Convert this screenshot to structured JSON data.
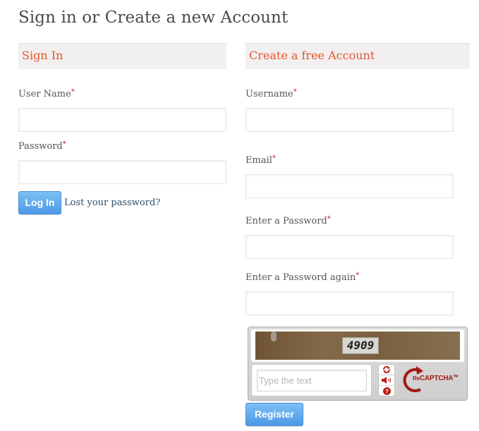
{
  "page": {
    "title": "Sign in or Create a new Account"
  },
  "sign_in": {
    "header": "Sign In",
    "username_label": "User Name",
    "username_value": "",
    "password_label": "Password",
    "password_value": "",
    "required_marker": "*",
    "login_button": "Log In",
    "lost_password_link": "Lost your password?"
  },
  "register": {
    "header": "Create a free Account",
    "username_label": "Username",
    "username_value": "",
    "email_label": "Email",
    "email_value": "",
    "password_label": "Enter a Password",
    "password_value": "",
    "password_again_label": "Enter a Password again",
    "password_again_value": "",
    "required_marker": "*",
    "register_button": "Register"
  },
  "captcha": {
    "image_text": "4909",
    "input_placeholder": "Type the text",
    "input_value": "",
    "controls": [
      "refresh-icon",
      "audio-icon",
      "help-icon"
    ],
    "brand_prefix": "Re",
    "brand_name": "CAPTCHA",
    "brand_tm": "TM"
  },
  "colors": {
    "accent": "#e0592e",
    "header_bg": "#f2eff0",
    "required": "#cc2222",
    "button": "#5aa6ec",
    "link": "#2d4f6c",
    "recaptcha_red": "#a11a12"
  }
}
